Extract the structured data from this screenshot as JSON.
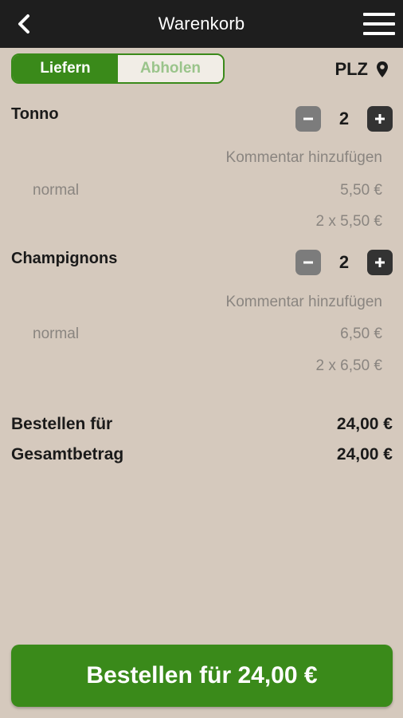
{
  "header": {
    "title": "Warenkorb",
    "back_icon": "chevron-left-icon",
    "menu_icon": "hamburger-menu-icon"
  },
  "delivery_toggle": {
    "options": [
      "Liefern",
      "Abholen"
    ],
    "selected": "Liefern"
  },
  "location": {
    "label": "PLZ",
    "icon": "map-pin-icon"
  },
  "items": [
    {
      "name": "Tonno",
      "quantity": "2",
      "comment": "Kommentar hinzufügen",
      "variant": "normal",
      "unit_price": "5,50 €",
      "line_total": "2 x 5,50 €"
    },
    {
      "name": "Champignons",
      "quantity": "2",
      "comment": "Kommentar hinzufügen",
      "variant": "normal",
      "unit_price": "6,50 €",
      "line_total": "2 x 6,50 €"
    }
  ],
  "summary": {
    "order_for_label": "Bestellen für",
    "order_for_value": "24,00 €",
    "total_label": "Gesamtbetrag",
    "total_value": "24,00 €"
  },
  "order_button": {
    "label": "Bestellen für 24,00 €"
  },
  "colors": {
    "accent": "#3a8a1a",
    "topbar": "#1e1e1e",
    "background": "#d5c9bd"
  }
}
